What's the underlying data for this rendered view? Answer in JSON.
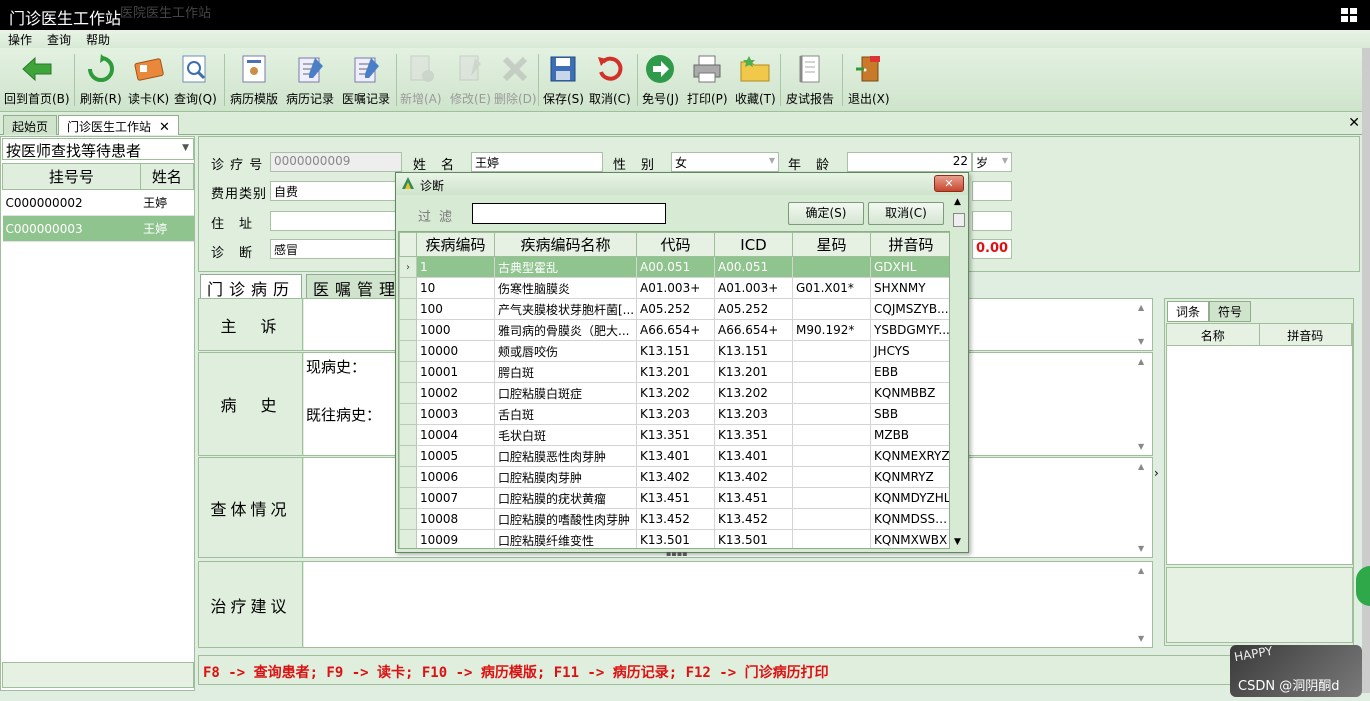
{
  "window": {
    "title": "门诊医生工作站",
    "ghost_text": "医院医生工作站"
  },
  "menu": [
    "操作",
    "查询",
    "帮助"
  ],
  "toolbar": [
    {
      "label": "回到首页(B)",
      "icon": "back-arrow-icon",
      "disabled": false
    },
    {
      "label": "刷新(R)",
      "icon": "refresh-icon",
      "disabled": false
    },
    {
      "label": "读卡(K)",
      "icon": "card-reader-icon",
      "disabled": false
    },
    {
      "label": "查询(Q)",
      "icon": "magnifier-icon",
      "disabled": false
    },
    {
      "label": "病历模版",
      "icon": "template-icon",
      "disabled": false
    },
    {
      "label": "病历记录",
      "icon": "record-icon",
      "disabled": false
    },
    {
      "label": "医嘱记录",
      "icon": "order-record-icon",
      "disabled": false
    },
    {
      "label": "新增(A)",
      "icon": "new-doc-icon",
      "disabled": true
    },
    {
      "label": "修改(E)",
      "icon": "edit-doc-icon",
      "disabled": true
    },
    {
      "label": "删除(D)",
      "icon": "delete-icon",
      "disabled": true
    },
    {
      "label": "保存(S)",
      "icon": "save-icon",
      "disabled": false
    },
    {
      "label": "取消(C)",
      "icon": "undo-icon",
      "disabled": false
    },
    {
      "label": "免号(J)",
      "icon": "next-arrow-icon",
      "disabled": false
    },
    {
      "label": "打印(P)",
      "icon": "printer-icon",
      "disabled": false
    },
    {
      "label": "收藏(T)",
      "icon": "favorite-folder-icon",
      "disabled": false
    },
    {
      "label": "皮试报告",
      "icon": "report-book-icon",
      "disabled": false
    },
    {
      "label": "退出(X)",
      "icon": "exit-door-icon",
      "disabled": false
    }
  ],
  "tabs": [
    {
      "label": "起始页"
    },
    {
      "label": "门诊医生工作站",
      "close": "✕"
    }
  ],
  "close_all": "✕",
  "left": {
    "filter_mode": "按医师查找等待患者",
    "columns": [
      "挂号号",
      "姓名"
    ],
    "rows": [
      {
        "id": "C000000002",
        "name": "王婷",
        "selected": false
      },
      {
        "id": "C000000003",
        "name": "王婷",
        "selected": true
      }
    ]
  },
  "form": {
    "visit_no_label": "诊 疗 号",
    "visit_no": "0000000009",
    "name_label": "姓　名",
    "name": "王婷",
    "gender_label": "性　别",
    "gender": "女",
    "age_label": "年　龄",
    "age": "22",
    "age_unit": "岁",
    "fee_label": "费用类别",
    "fee_type": "自费",
    "address_label": "住　址",
    "address": "",
    "diag_label": "诊　断",
    "diagnosis": "感冒",
    "amount": "0.00"
  },
  "record_tabs": [
    "门诊病历",
    "医嘱管理"
  ],
  "sections": {
    "chief": "主　诉",
    "history": "病　史",
    "history_present": "现病史：",
    "history_past": "既往病史：",
    "exam": "查体情况",
    "advice": "治疗建议"
  },
  "hotkeys": "F8 -> 查询患者; F9 -> 读卡; F10 -> 病历模版; F11 -> 病历记录; F12 -> 门诊病历打印",
  "right": {
    "tabs": [
      "词条",
      "符号"
    ],
    "columns": [
      "名称",
      "拼音码"
    ]
  },
  "dialog": {
    "title": "诊断",
    "filter_label": "过滤",
    "filter_value": "",
    "ok": "确定(S)",
    "cancel": "取消(C)",
    "close": "✕",
    "columns": [
      "疾病编码",
      "疾病编码名称",
      "代码",
      "ICD",
      "星码",
      "拼音码"
    ],
    "rows": [
      {
        "code": "1",
        "name": "古典型霍乱",
        "dm": "A00.051",
        "icd": "A00.051",
        "star": "",
        "py": "GDXHL"
      },
      {
        "code": "10",
        "name": "伤寒性脑膜炎",
        "dm": "A01.003+",
        "icd": "A01.003+",
        "star": "G01.X01*",
        "py": "SHXNMY"
      },
      {
        "code": "100",
        "name": "产气夹膜梭状芽胞杆菌[...",
        "dm": "A05.252",
        "icd": "A05.252",
        "star": "",
        "py": "CQJMSZYB..."
      },
      {
        "code": "1000",
        "name": "雅司病的骨膜炎（肥大...",
        "dm": "A66.654+",
        "icd": "A66.654+",
        "star": "M90.192*",
        "py": "YSBDGMYF..."
      },
      {
        "code": "10000",
        "name": "颊或唇咬伤",
        "dm": "K13.151",
        "icd": "K13.151",
        "star": "",
        "py": "JHCYS"
      },
      {
        "code": "10001",
        "name": "腭白斑",
        "dm": "K13.201",
        "icd": "K13.201",
        "star": "",
        "py": "EBB"
      },
      {
        "code": "10002",
        "name": "口腔粘膜白斑症",
        "dm": "K13.202",
        "icd": "K13.202",
        "star": "",
        "py": "KQNMBBZ"
      },
      {
        "code": "10003",
        "name": "舌白斑",
        "dm": "K13.203",
        "icd": "K13.203",
        "star": "",
        "py": "SBB"
      },
      {
        "code": "10004",
        "name": "毛状白斑",
        "dm": "K13.351",
        "icd": "K13.351",
        "star": "",
        "py": "MZBB"
      },
      {
        "code": "10005",
        "name": "口腔粘膜恶性肉芽肿",
        "dm": "K13.401",
        "icd": "K13.401",
        "star": "",
        "py": "KQNMEXRYZ"
      },
      {
        "code": "10006",
        "name": "口腔粘膜肉芽肿",
        "dm": "K13.402",
        "icd": "K13.402",
        "star": "",
        "py": "KQNMRYZ"
      },
      {
        "code": "10007",
        "name": "口腔粘膜的疣状黄瘤",
        "dm": "K13.451",
        "icd": "K13.451",
        "star": "",
        "py": "KQNMDYZHL"
      },
      {
        "code": "10008",
        "name": "口腔粘膜的嗜酸性肉芽肿",
        "dm": "K13.452",
        "icd": "K13.452",
        "star": "",
        "py": "KQNMDSSX..."
      },
      {
        "code": "10009",
        "name": "口腔粘膜纤维变性",
        "dm": "K13.501",
        "icd": "K13.501",
        "star": "",
        "py": "KQNMXWBX"
      }
    ]
  },
  "watermark": {
    "badge": "HAPPY",
    "text": "CSDN @洞阴酮d"
  }
}
